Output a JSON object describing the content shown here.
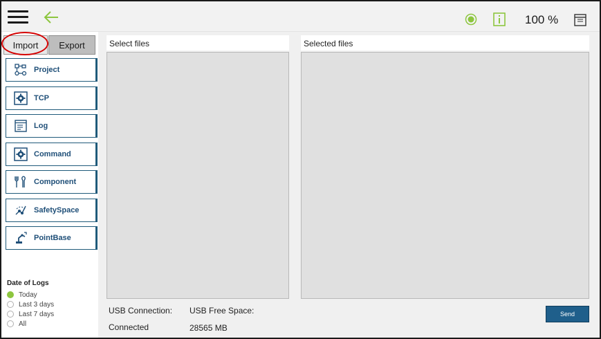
{
  "topbar": {
    "zoom": "100 %",
    "status_color": "#8dc63f"
  },
  "tabs": {
    "import_label": "Import",
    "export_label": "Export"
  },
  "nav": [
    {
      "label": "Project",
      "icon": "project-icon"
    },
    {
      "label": "TCP",
      "icon": "tcp-gear-icon"
    },
    {
      "label": "Log",
      "icon": "log-icon"
    },
    {
      "label": "Command",
      "icon": "command-gear-icon"
    },
    {
      "label": "Component",
      "icon": "component-icon"
    },
    {
      "label": "SafetySpace",
      "icon": "safety-space-icon"
    },
    {
      "label": "PointBase",
      "icon": "point-base-icon"
    }
  ],
  "logs": {
    "title": "Date of Logs",
    "options": [
      "Today",
      "Last 3 days",
      "Last 7 days",
      "All"
    ],
    "selected": "Today"
  },
  "panes": {
    "select_label": "Select files",
    "selected_label": "Selected files"
  },
  "usb": {
    "connection_label": "USB Connection:",
    "connection_value": "Connected",
    "free_label": "USB Free Space:",
    "free_value": "28565 MB"
  },
  "send_label": "Send",
  "colors": {
    "accent_blue": "#1f5f8b",
    "green": "#8dc63f",
    "highlight_red": "#d40000"
  }
}
